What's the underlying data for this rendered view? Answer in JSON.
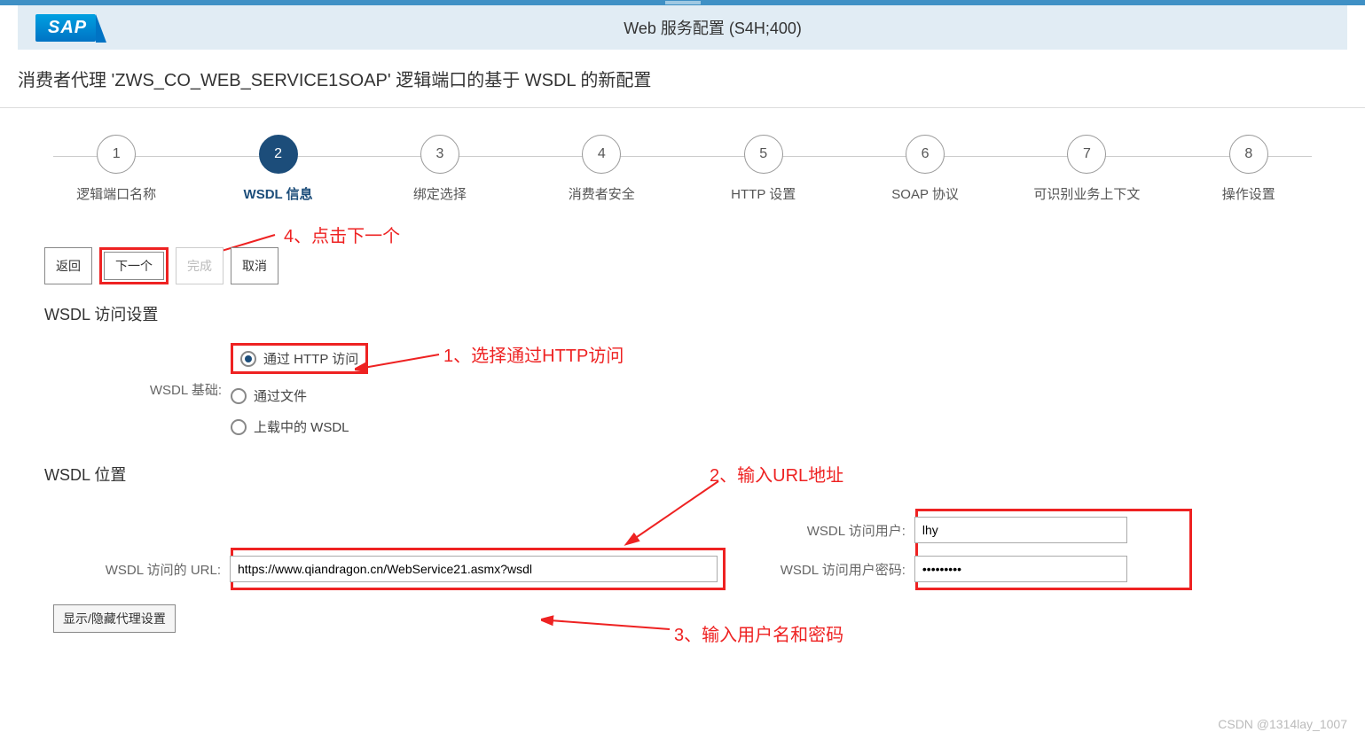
{
  "header": {
    "logo": "SAP",
    "title": "Web 服务配置 (S4H;400)"
  },
  "page_title": "消费者代理 'ZWS_CO_WEB_SERVICE1SOAP' 逻辑端口的基于 WSDL 的新配置",
  "wizard": {
    "active_index": 1,
    "steps": [
      {
        "num": "1",
        "label": "逻辑端口名称"
      },
      {
        "num": "2",
        "label": "WSDL 信息"
      },
      {
        "num": "3",
        "label": "绑定选择"
      },
      {
        "num": "4",
        "label": "消费者安全"
      },
      {
        "num": "5",
        "label": "HTTP 设置"
      },
      {
        "num": "6",
        "label": "SOAP 协议"
      },
      {
        "num": "7",
        "label": "可识别业务上下文"
      },
      {
        "num": "8",
        "label": "操作设置"
      }
    ]
  },
  "buttons": {
    "back": "返回",
    "next": "下一个",
    "finish": "完成",
    "cancel": "取消"
  },
  "sections": {
    "access": {
      "title": "WSDL 访问设置",
      "base_label": "WSDL 基础:",
      "options": {
        "http": "通过 HTTP 访问",
        "file": "通过文件",
        "upload": "上载中的 WSDL"
      }
    },
    "location": {
      "title": "WSDL 位置",
      "url_label": "WSDL 访问的 URL:",
      "url_value": "https://www.qiandragon.cn/WebService21.asmx?wsdl",
      "user_label": "WSDL 访问用户:",
      "user_value": "lhy",
      "pwd_label": "WSDL 访问用户密码:",
      "pwd_value": "•••••••••",
      "proxy_btn": "显示/隐藏代理设置"
    }
  },
  "annotations": {
    "a1": "1、选择通过HTTP访问",
    "a2": "2、输入URL地址",
    "a3": "3、输入用户名和密码",
    "a4": "4、点击下一个"
  },
  "watermark": "CSDN @1314lay_1007"
}
